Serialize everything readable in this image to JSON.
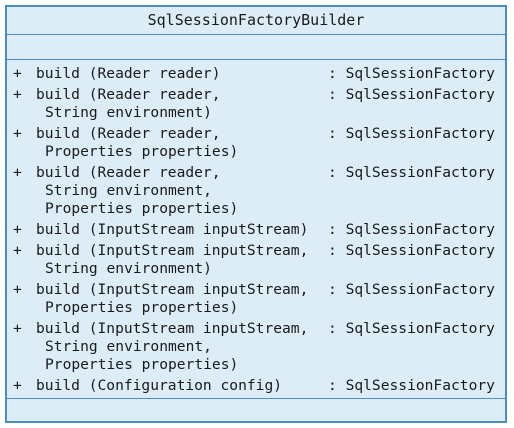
{
  "class_name": "SqlSessionFactoryBuilder",
  "operations": [
    {
      "visibility": "+",
      "lines": [
        "build (Reader reader)"
      ],
      "return_type": ": SqlSessionFactory"
    },
    {
      "visibility": "+",
      "lines": [
        "build (Reader reader,",
        "String environment)"
      ],
      "return_type": ": SqlSessionFactory"
    },
    {
      "visibility": "+",
      "lines": [
        "build (Reader reader,",
        "Properties properties)"
      ],
      "return_type": ": SqlSessionFactory"
    },
    {
      "visibility": "+",
      "lines": [
        "build (Reader reader,",
        "String environment,",
        "Properties properties)"
      ],
      "return_type": ": SqlSessionFactory"
    },
    {
      "visibility": "+",
      "lines": [
        "build (InputStream inputStream)"
      ],
      "return_type": ": SqlSessionFactory"
    },
    {
      "visibility": "+",
      "lines": [
        "build (InputStream inputStream,",
        "String environment)"
      ],
      "return_type": ": SqlSessionFactory"
    },
    {
      "visibility": "+",
      "lines": [
        "build (InputStream inputStream,",
        "Properties properties)"
      ],
      "return_type": ": SqlSessionFactory"
    },
    {
      "visibility": "+",
      "lines": [
        "build (InputStream inputStream,",
        "String environment,",
        "Properties properties)"
      ],
      "return_type": ": SqlSessionFactory"
    },
    {
      "visibility": "+",
      "lines": [
        "build (Configuration config)"
      ],
      "return_type": ": SqlSessionFactory"
    }
  ],
  "colors": {
    "border": "#4a8fc4",
    "fill": "#dcedf8",
    "text": "#1a1a1a"
  }
}
